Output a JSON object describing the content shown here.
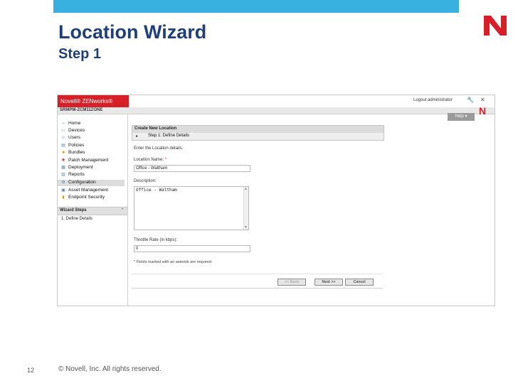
{
  "slide": {
    "title": "Location Wizard",
    "subtitle": "Step 1",
    "slide_number": "12",
    "copyright": "© Novell, Inc.  All rights reserved.",
    "colors": {
      "top_bar": "#38b1e0",
      "title": "#1f3f78",
      "brand_red": "#d61f26"
    }
  },
  "app": {
    "brand": "Novell® ZENworks®",
    "logout": "Logout administrator",
    "zone": "SRMPM-ZCM11ZONE",
    "help": "Help ▾",
    "nav": [
      {
        "label": "Home",
        "icon": "home-icon"
      },
      {
        "label": "Devices",
        "icon": "devices-icon"
      },
      {
        "label": "Users",
        "icon": "users-icon"
      },
      {
        "label": "Policies",
        "icon": "policies-icon"
      },
      {
        "label": "Bundles",
        "icon": "bundles-icon"
      },
      {
        "label": "Patch Management",
        "icon": "patch-icon"
      },
      {
        "label": "Deployment",
        "icon": "deployment-icon"
      },
      {
        "label": "Reports",
        "icon": "reports-icon"
      },
      {
        "label": "Configuration",
        "icon": "configuration-icon"
      },
      {
        "label": "Asset Management",
        "icon": "asset-icon"
      },
      {
        "label": "Endpoint Security",
        "icon": "endpoint-icon"
      }
    ],
    "wizard_steps_header": "Wizard Steps",
    "wizard_steps": [
      "1. Define Details"
    ]
  },
  "form": {
    "panel_title": "Create New Location",
    "step_label": "Step 1: Define Details",
    "intro": "Enter the Location details.",
    "location_name_label": "Location Name:",
    "required_mark": "*",
    "location_name_value": "Office - Waltham",
    "description_label": "Description:",
    "description_value": "Office - Waltham",
    "throttle_label": "Throttle Rate (in kbps):",
    "throttle_value": "0",
    "footnote": "* Fields marked with an asterisk are required.",
    "back_button": "<< Back",
    "next_button": "Next >>",
    "cancel_button": "Cancel"
  }
}
